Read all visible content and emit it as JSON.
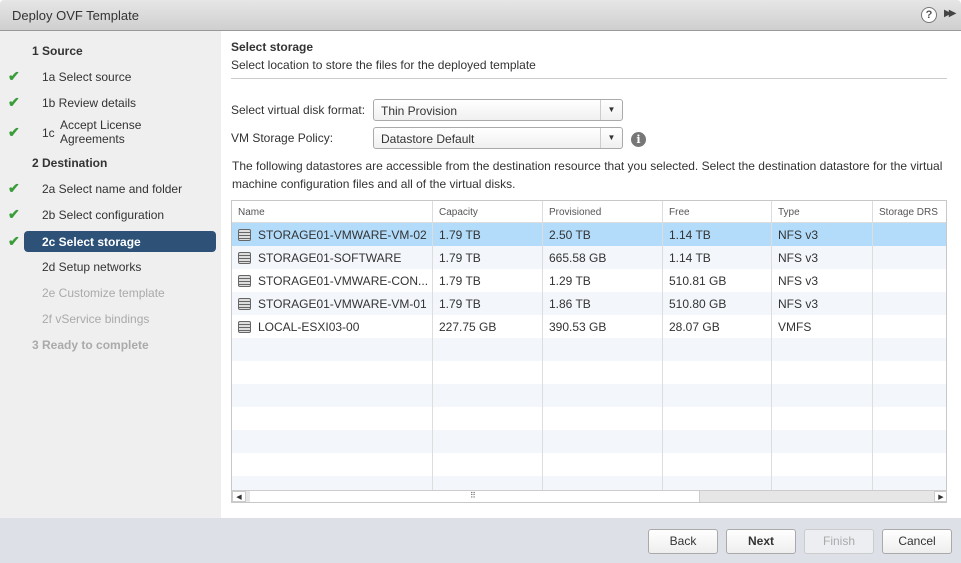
{
  "window": {
    "title": "Deploy OVF Template",
    "help_icon": "question-circle-icon",
    "expand_icon": "fast-forward-icon"
  },
  "sidebar": {
    "items": [
      {
        "label": "1  Source",
        "type": "header",
        "state": "normal"
      },
      {
        "label": "1a  Select source",
        "state": "done"
      },
      {
        "label": "1b  Review details",
        "state": "done"
      },
      {
        "prefix": "1c",
        "label": "Accept License Agreements",
        "state": "done"
      },
      {
        "label": "2  Destination",
        "type": "header",
        "state": "normal"
      },
      {
        "label": "2a  Select name and folder",
        "state": "done"
      },
      {
        "label": "2b  Select configuration",
        "state": "done"
      },
      {
        "label": "2c  Select storage",
        "state": "current"
      },
      {
        "label": "2d  Setup networks",
        "state": "normal"
      },
      {
        "label": "2e  Customize template",
        "state": "disabled"
      },
      {
        "label": "2f  vService bindings",
        "state": "disabled"
      },
      {
        "label": "3  Ready to complete",
        "type": "header",
        "state": "disabled"
      }
    ]
  },
  "main": {
    "title": "Select storage",
    "subtitle": "Select location to store the files for the deployed template",
    "disk_format": {
      "label": "Select virtual disk format:",
      "value": "Thin Provision"
    },
    "storage_policy": {
      "label": "VM Storage Policy:",
      "value": "Datastore Default"
    },
    "description": "The following datastores are accessible from the destination resource that you selected. Select the destination datastore for the virtual machine configuration files and all of the virtual disks.",
    "table": {
      "columns": [
        "Name",
        "Capacity",
        "Provisioned",
        "Free",
        "Type",
        "Storage DRS"
      ],
      "rows": [
        [
          "STORAGE01-VMWARE-VM-02",
          "1.79 TB",
          "2.50 TB",
          "1.14 TB",
          "NFS v3",
          ""
        ],
        [
          "STORAGE01-SOFTWARE",
          "1.79 TB",
          "665.58 GB",
          "1.14 TB",
          "NFS v3",
          ""
        ],
        [
          "STORAGE01-VMWARE-CON...",
          "1.79 TB",
          "1.29 TB",
          "510.81 GB",
          "NFS v3",
          ""
        ],
        [
          "STORAGE01-VMWARE-VM-01",
          "1.79 TB",
          "1.86 TB",
          "510.80 GB",
          "NFS v3",
          ""
        ],
        [
          "LOCAL-ESXI03-00",
          "227.75 GB",
          "390.53 GB",
          "28.07 GB",
          "VMFS",
          ""
        ]
      ],
      "selected_row": 0
    }
  },
  "footer": {
    "back": "Back",
    "next": "Next",
    "finish": "Finish",
    "cancel": "Cancel"
  },
  "colors": {
    "selected_step": "#2d5177",
    "selected_row": "#b3dcfb",
    "check": "#3a9d3a"
  }
}
